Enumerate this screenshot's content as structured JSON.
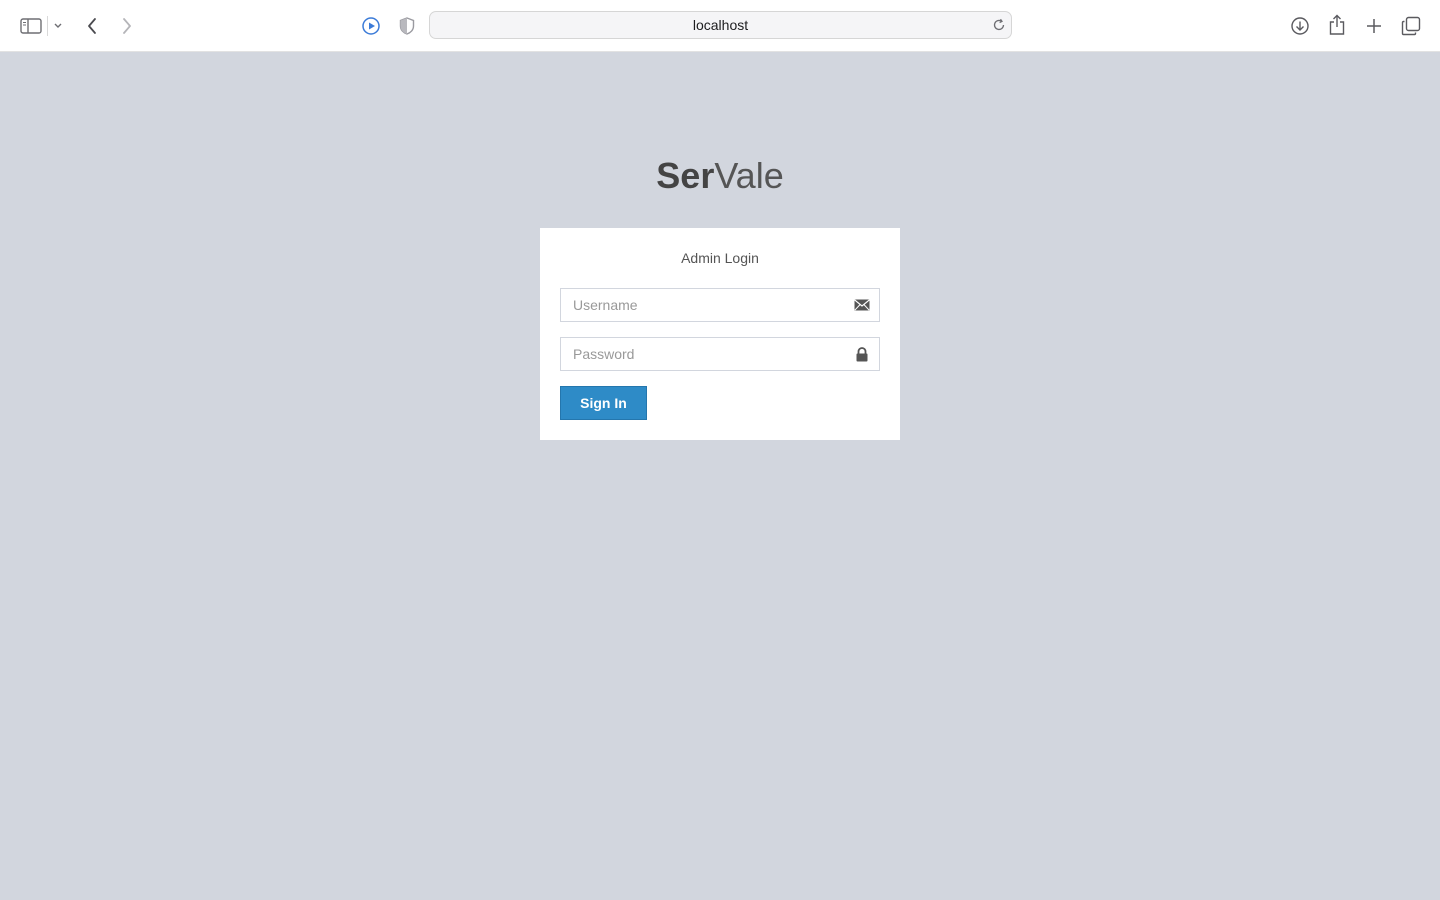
{
  "browser": {
    "address": "localhost",
    "icons": [
      "sidebar-icon",
      "chevron-down-icon",
      "back-icon",
      "forward-icon",
      "media-play-icon",
      "shield-icon",
      "reload-icon",
      "download-icon",
      "share-icon",
      "plus-icon",
      "tabs-icon"
    ]
  },
  "logo": {
    "bold": "Ser",
    "light": "Vale"
  },
  "login": {
    "message": "Admin Login",
    "username_placeholder": "Username",
    "username_value": "",
    "password_placeholder": "Password",
    "password_value": "",
    "signin_label": "Sign In"
  },
  "colors": {
    "page_bg": "#d2d6de",
    "primary_button": "#2e8bc7"
  }
}
